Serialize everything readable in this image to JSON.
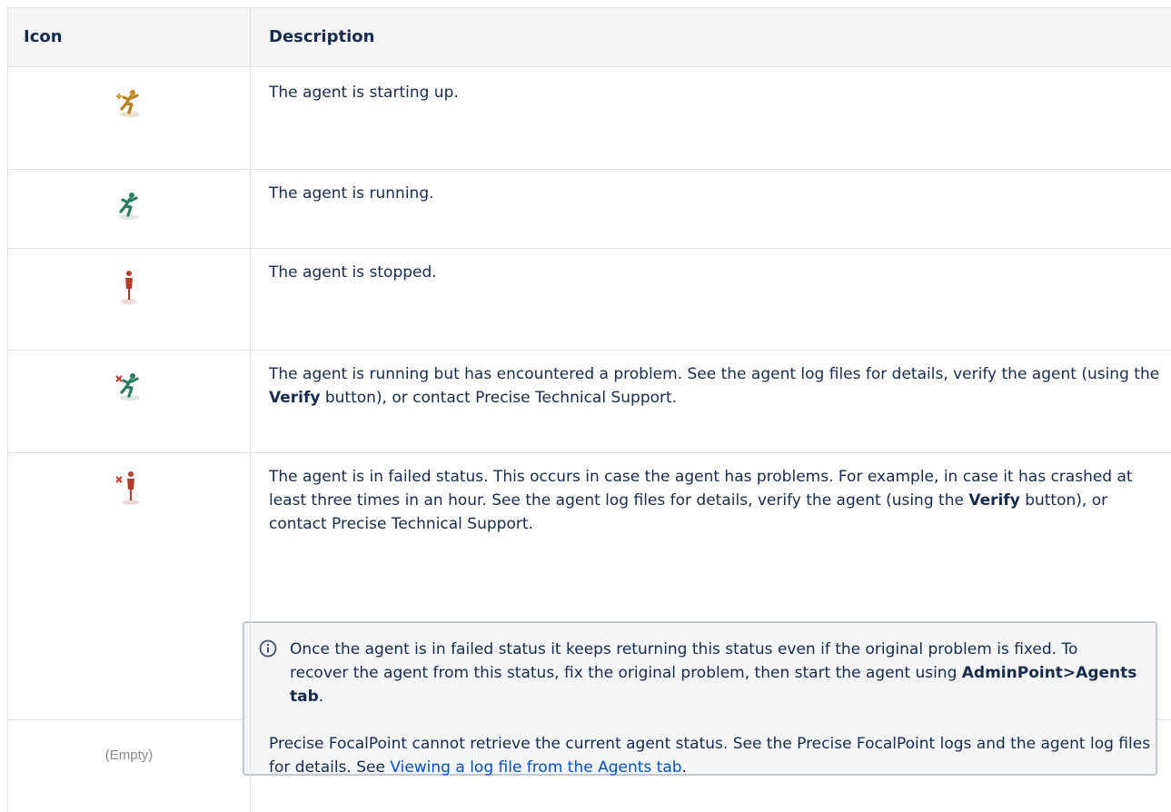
{
  "headers": {
    "icon": "Icon",
    "description": "Description"
  },
  "rows": [
    {
      "icon": "agent-starting-icon",
      "text": "The agent is starting up."
    },
    {
      "icon": "agent-running-icon",
      "text": "The agent is running."
    },
    {
      "icon": "agent-stopped-icon",
      "text": "The agent is stopped."
    },
    {
      "icon": "agent-running-problem-icon",
      "text_pre": "The agent is running but has encountered a problem. See the agent log files for details, verify the agent (using the ",
      "bold": "Verify",
      "text_post": " button), or contact Precise Technical Support."
    },
    {
      "icon": "agent-failed-icon",
      "text_pre": "The agent is in failed status. This occurs in case the agent has problems. For example, in case it has crashed at least three times in an hour. See the agent log files for details, verify the agent (using the ",
      "bold": "Verify",
      "text_post": " button), or contact Precise Technical Support.",
      "info": {
        "icon": "info-icon",
        "text_pre": "Once the agent is in failed status it keeps returning this status even if the original problem is fixed. To recover the agent from this status, fix the original problem, then start the agent using ",
        "bold": "AdminPoint>Agents tab",
        "text_post": "."
      }
    },
    {
      "icon_label": "(Empty)",
      "text_pre": "Precise FocalPoint cannot retrieve the current agent status. See the Precise FocalPoint logs and the agent log files for details. See ",
      "link": "Viewing a log file from the Agents tab",
      "text_post": "."
    }
  ],
  "colors": {
    "header_bg": "#f4f5f7",
    "border": "#dfe1e6",
    "link": "#0052cc",
    "text": "#172b4d"
  }
}
